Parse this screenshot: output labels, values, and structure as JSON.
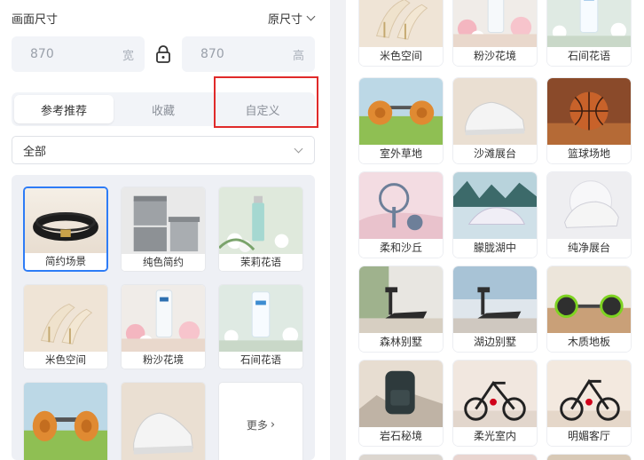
{
  "size": {
    "title": "画面尺寸",
    "mode": "原尺寸",
    "width_value": "870",
    "width_unit": "宽",
    "height_value": "870",
    "height_unit": "高"
  },
  "tabs": [
    {
      "label": "参考推荐",
      "active": true
    },
    {
      "label": "收藏",
      "active": false
    },
    {
      "label": "自定义",
      "active": false
    }
  ],
  "filter": {
    "selected": "全部"
  },
  "left_grid": [
    {
      "label": "简约场景",
      "scene": "bracelet",
      "selected": true
    },
    {
      "label": "纯色简约",
      "scene": "boxes",
      "selected": false
    },
    {
      "label": "茉莉花语",
      "scene": "jasmine",
      "selected": false
    },
    {
      "label": "米色空间",
      "scene": "heels",
      "selected": false
    },
    {
      "label": "粉沙花境",
      "scene": "tube",
      "selected": false
    },
    {
      "label": "石间花语",
      "scene": "tube2",
      "selected": false
    },
    {
      "label": "",
      "scene": "dumbbell",
      "selected": false
    },
    {
      "label": "",
      "scene": "shoe",
      "selected": false
    }
  ],
  "more_label": "更多",
  "right_grid": [
    {
      "label": "米色空间",
      "scene": "heels"
    },
    {
      "label": "粉沙花境",
      "scene": "tube"
    },
    {
      "label": "石间花语",
      "scene": "tube2"
    },
    {
      "label": "室外草地",
      "scene": "dumbbell"
    },
    {
      "label": "沙滩展台",
      "scene": "shoe"
    },
    {
      "label": "篮球场地",
      "scene": "basketball"
    },
    {
      "label": "柔和沙丘",
      "scene": "pink"
    },
    {
      "label": "朦胧湖中",
      "scene": "lake"
    },
    {
      "label": "纯净展台",
      "scene": "pure"
    },
    {
      "label": "森林别墅",
      "scene": "treadmill"
    },
    {
      "label": "湖边别墅",
      "scene": "treadmill2"
    },
    {
      "label": "木质地板",
      "scene": "roller"
    },
    {
      "label": "岩石秘境",
      "scene": "backpack"
    },
    {
      "label": "柔光室内",
      "scene": "bike"
    },
    {
      "label": "明媚客厅",
      "scene": "bike2"
    }
  ],
  "colors": {
    "accent": "#2e7cf6",
    "highlight_box": "#e02a2a"
  }
}
